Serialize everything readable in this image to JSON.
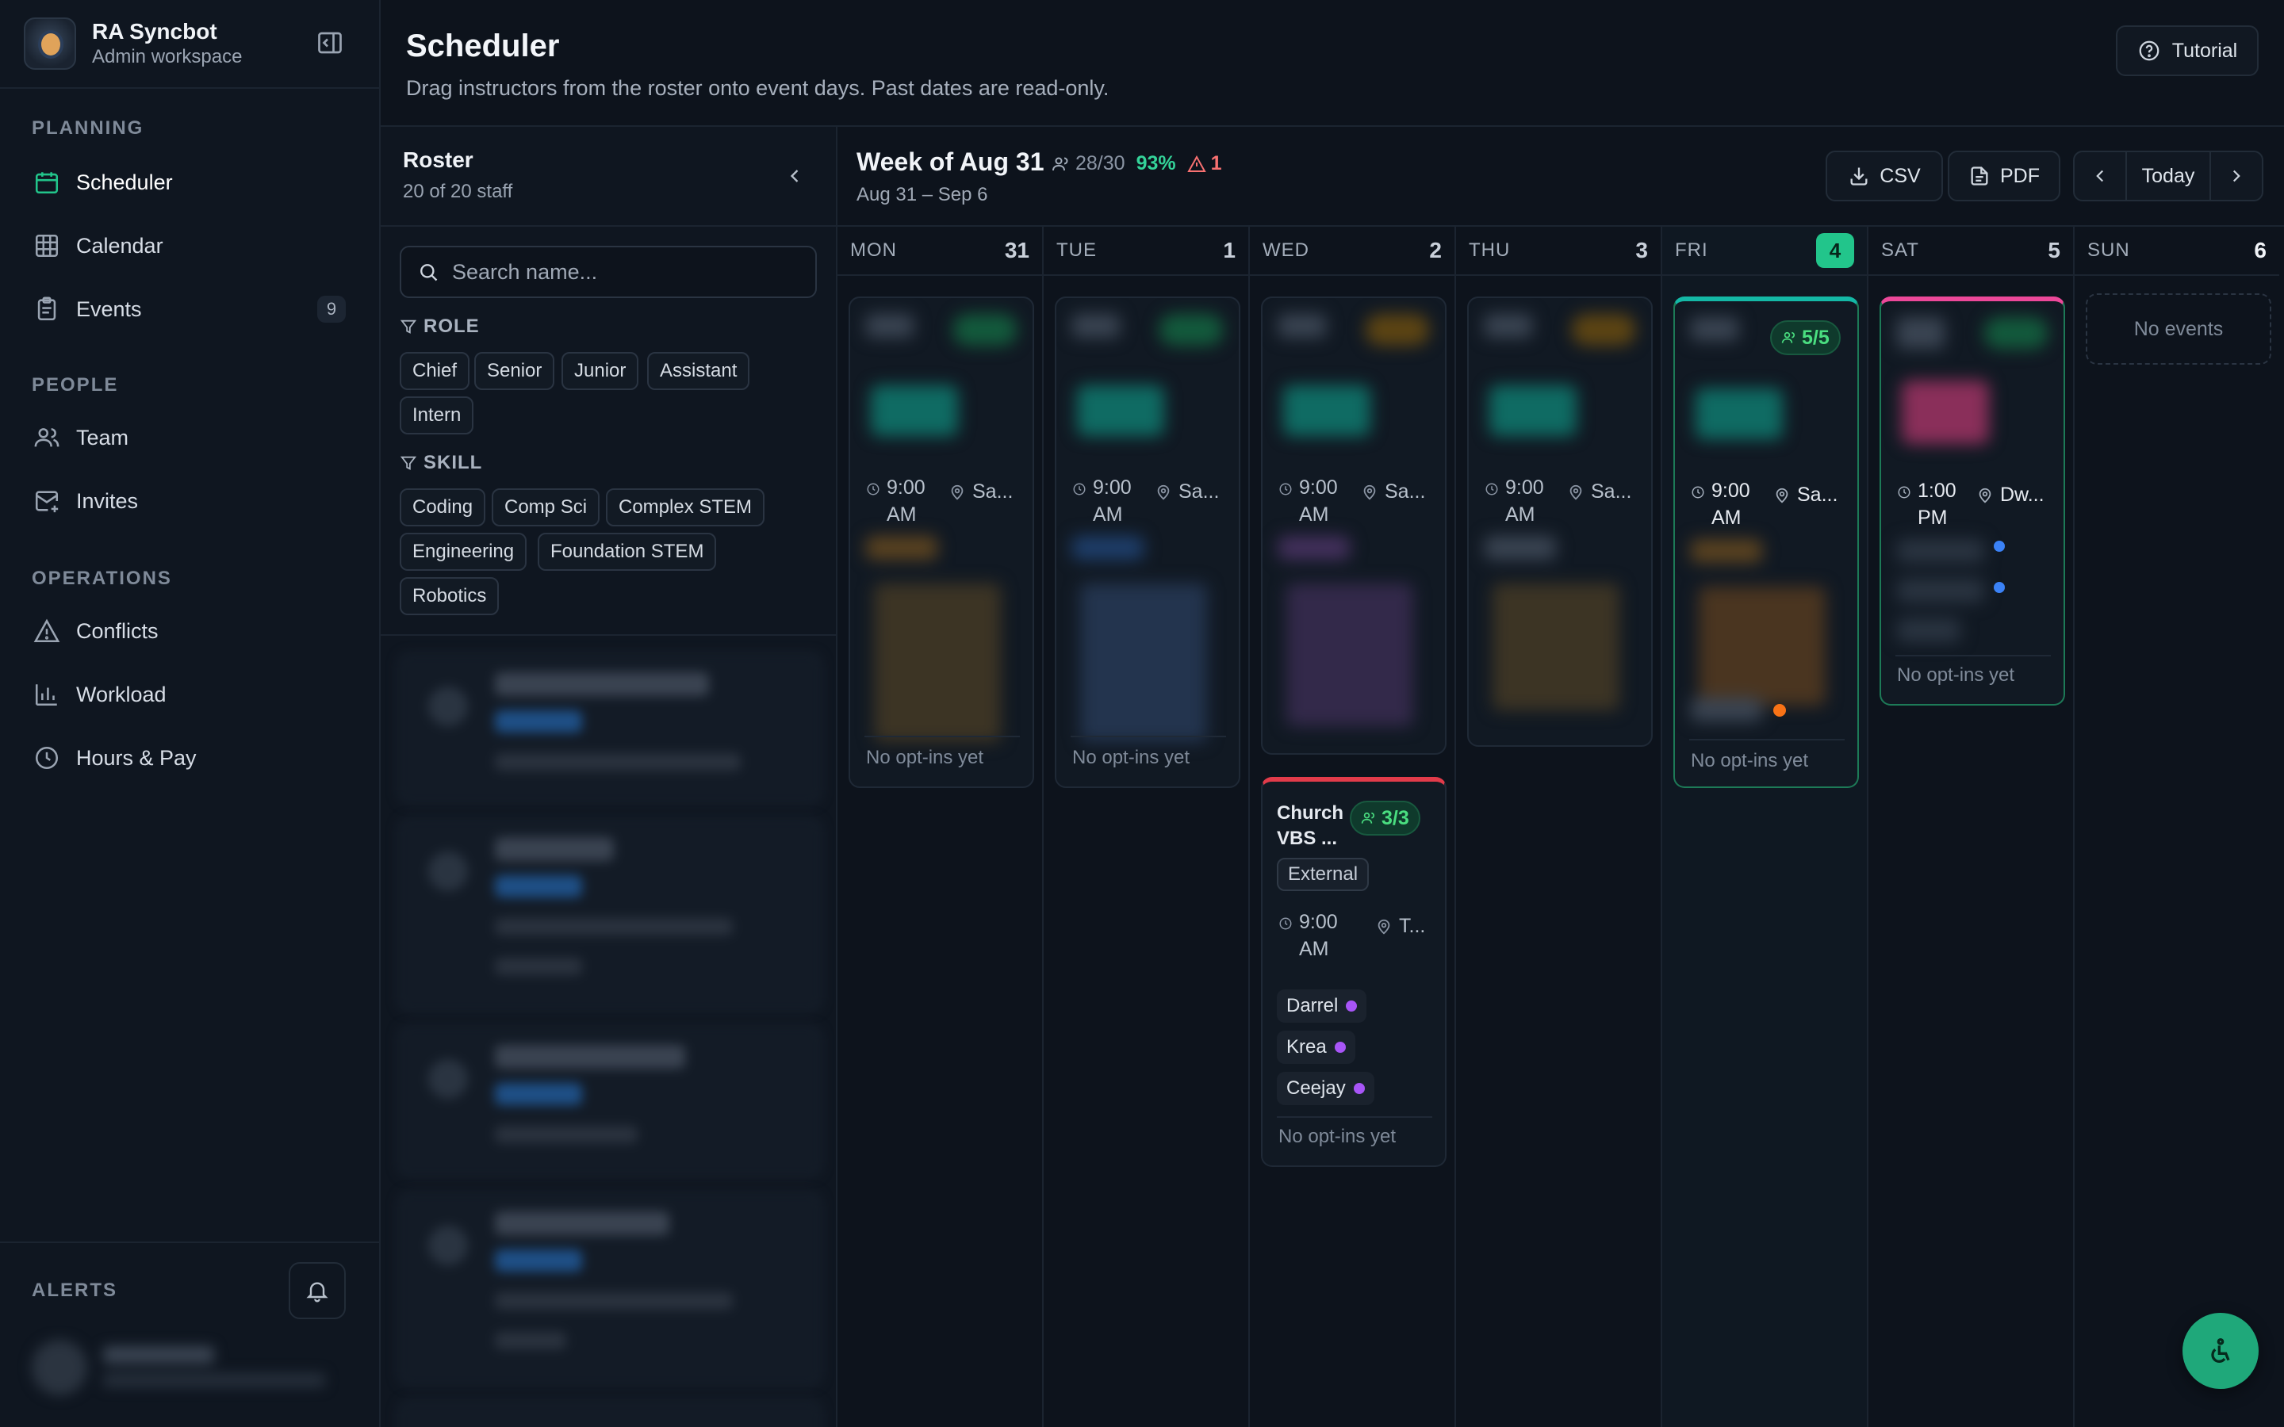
{
  "brand": {
    "name": "RA Syncbot",
    "subtitle": "Admin workspace"
  },
  "nav": {
    "planning_label": "PLANNING",
    "people_label": "PEOPLE",
    "operations_label": "OPERATIONS",
    "items": [
      {
        "label": "Scheduler",
        "icon": "calendar-check-icon"
      },
      {
        "label": "Calendar",
        "icon": "grid-icon"
      },
      {
        "label": "Events",
        "icon": "clipboard-icon",
        "badge": "9"
      },
      {
        "label": "Team",
        "icon": "users-icon"
      },
      {
        "label": "Invites",
        "icon": "mail-plus-icon"
      },
      {
        "label": "Conflicts",
        "icon": "alert-triangle-icon"
      },
      {
        "label": "Workload",
        "icon": "bar-chart-icon"
      },
      {
        "label": "Hours & Pay",
        "icon": "clock-icon"
      }
    ],
    "alerts_label": "ALERTS"
  },
  "header": {
    "title": "Scheduler",
    "subtitle": "Drag instructors from the roster onto event days. Past dates are read-only.",
    "tutorial_label": "Tutorial"
  },
  "roster": {
    "title": "Roster",
    "count": "20 of 20 staff",
    "search_placeholder": "Search name...",
    "role_label": "ROLE",
    "roles": [
      "Chief",
      "Senior",
      "Junior",
      "Assistant",
      "Intern"
    ],
    "skill_label": "SKILL",
    "skills": [
      "Coding",
      "Comp Sci",
      "Complex STEM",
      "Engineering",
      "Foundation STEM",
      "Robotics"
    ]
  },
  "week": {
    "title": "Week of Aug 31",
    "staffed": "28/30",
    "percent": "93%",
    "warnings": "1",
    "range": "Aug 31 – Sep 6",
    "csv_label": "CSV",
    "pdf_label": "PDF",
    "today_label": "Today"
  },
  "days": [
    {
      "name": "MON",
      "num": "31"
    },
    {
      "name": "TUE",
      "num": "1"
    },
    {
      "name": "WED",
      "num": "2"
    },
    {
      "name": "THU",
      "num": "3"
    },
    {
      "name": "FRI",
      "num": "4"
    },
    {
      "name": "SAT",
      "num": "5"
    },
    {
      "name": "SUN",
      "num": "6"
    }
  ],
  "events": {
    "time_9am": "9:00 AM",
    "time_1pm": "1:00 PM",
    "loc_sa": "Sa...",
    "loc_dw": "Dw...",
    "loc_t": "T...",
    "no_optins": "No opt-ins yet",
    "no_events": "No events",
    "fri_count": "5/5",
    "church": {
      "title": "Church VBS ...",
      "count": "3/3",
      "tag": "External",
      "people": [
        "Darrel",
        "Krea",
        "Ceejay"
      ]
    }
  },
  "colors": {
    "accent": "#22c58b",
    "purple_dot": "#a855f7",
    "orange_dot": "#f97316",
    "blue_dot": "#3b82f6",
    "church_bar": "#e23b4a",
    "sat_bar": "#ec4899",
    "fri_bar": "#14b8a6"
  }
}
